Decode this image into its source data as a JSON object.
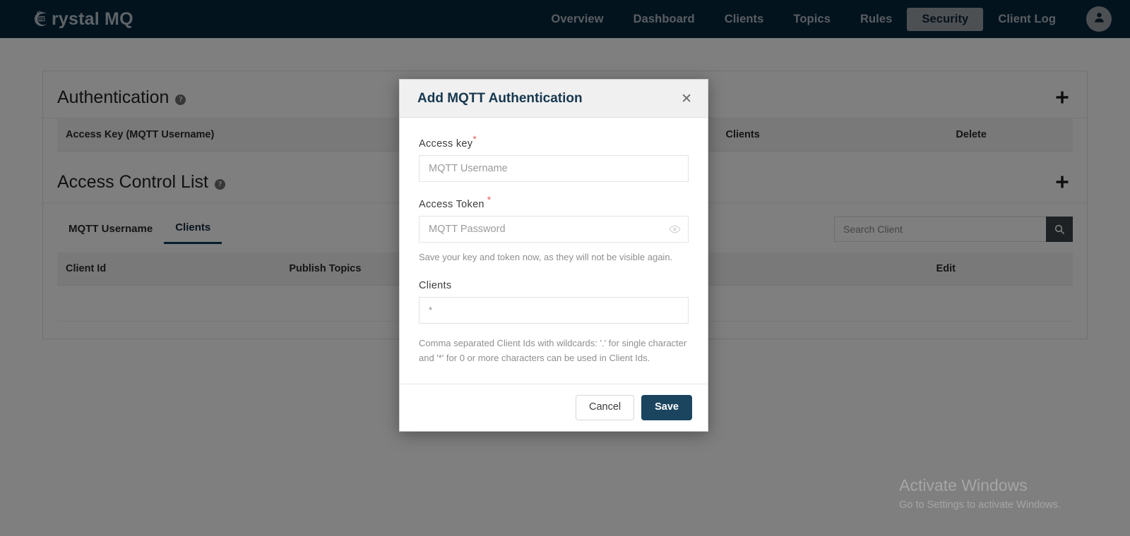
{
  "navbar": {
    "brand": "rystal MQ",
    "brand_icon": "crystal-logo-icon",
    "links": [
      {
        "label": "Overview",
        "active": false
      },
      {
        "label": "Dashboard",
        "active": false
      },
      {
        "label": "Clients",
        "active": false
      },
      {
        "label": "Topics",
        "active": false
      },
      {
        "label": "Rules",
        "active": false
      },
      {
        "label": "Security",
        "active": true
      },
      {
        "label": "Client Log",
        "active": false
      }
    ],
    "avatar_icon": "user-icon"
  },
  "authentication": {
    "title": "Authentication",
    "help_icon": "question-mark-icon",
    "add_icon": "plus-icon",
    "columns": [
      "Access Key (MQTT Username)",
      "Clients",
      "Delete"
    ],
    "rows": []
  },
  "acl": {
    "title": "Access Control List",
    "help_icon": "question-mark-icon",
    "add_icon": "plus-icon",
    "tabs": [
      {
        "label": "MQTT Username",
        "active": false
      },
      {
        "label": "Clients",
        "active": true
      }
    ],
    "search": {
      "placeholder": "Search Client",
      "value": "",
      "icon": "search-icon"
    },
    "columns": [
      "Client Id",
      "Publish Topics",
      "Edit"
    ],
    "rows": []
  },
  "modal": {
    "title": "Add MQTT Authentication",
    "close_icon": "close-icon",
    "access_key": {
      "label": "Access key",
      "required_marker": "*",
      "placeholder": "MQTT Username",
      "value": ""
    },
    "access_token": {
      "label": "Access Token",
      "required_marker": "*",
      "placeholder": "MQTT Password",
      "value": "",
      "reveal_icon": "eye-icon"
    },
    "token_hint": "Save your key and token now, as they will not be visible again.",
    "clients": {
      "label": "Clients",
      "value": "*"
    },
    "clients_hint": "Comma separated Client Ids with wildcards: '.' for single character and '*' for 0 or more characters can be used in Client Ids.",
    "cancel_label": "Cancel",
    "save_label": "Save"
  },
  "watermark": {
    "title": "Activate Windows",
    "subtitle": "Go to Settings to activate Windows."
  },
  "colors": {
    "navbar_bg": "#06263d",
    "accent": "#1b445f",
    "required": "#e8605f",
    "active_tab_underline": "#0d3b5c"
  }
}
